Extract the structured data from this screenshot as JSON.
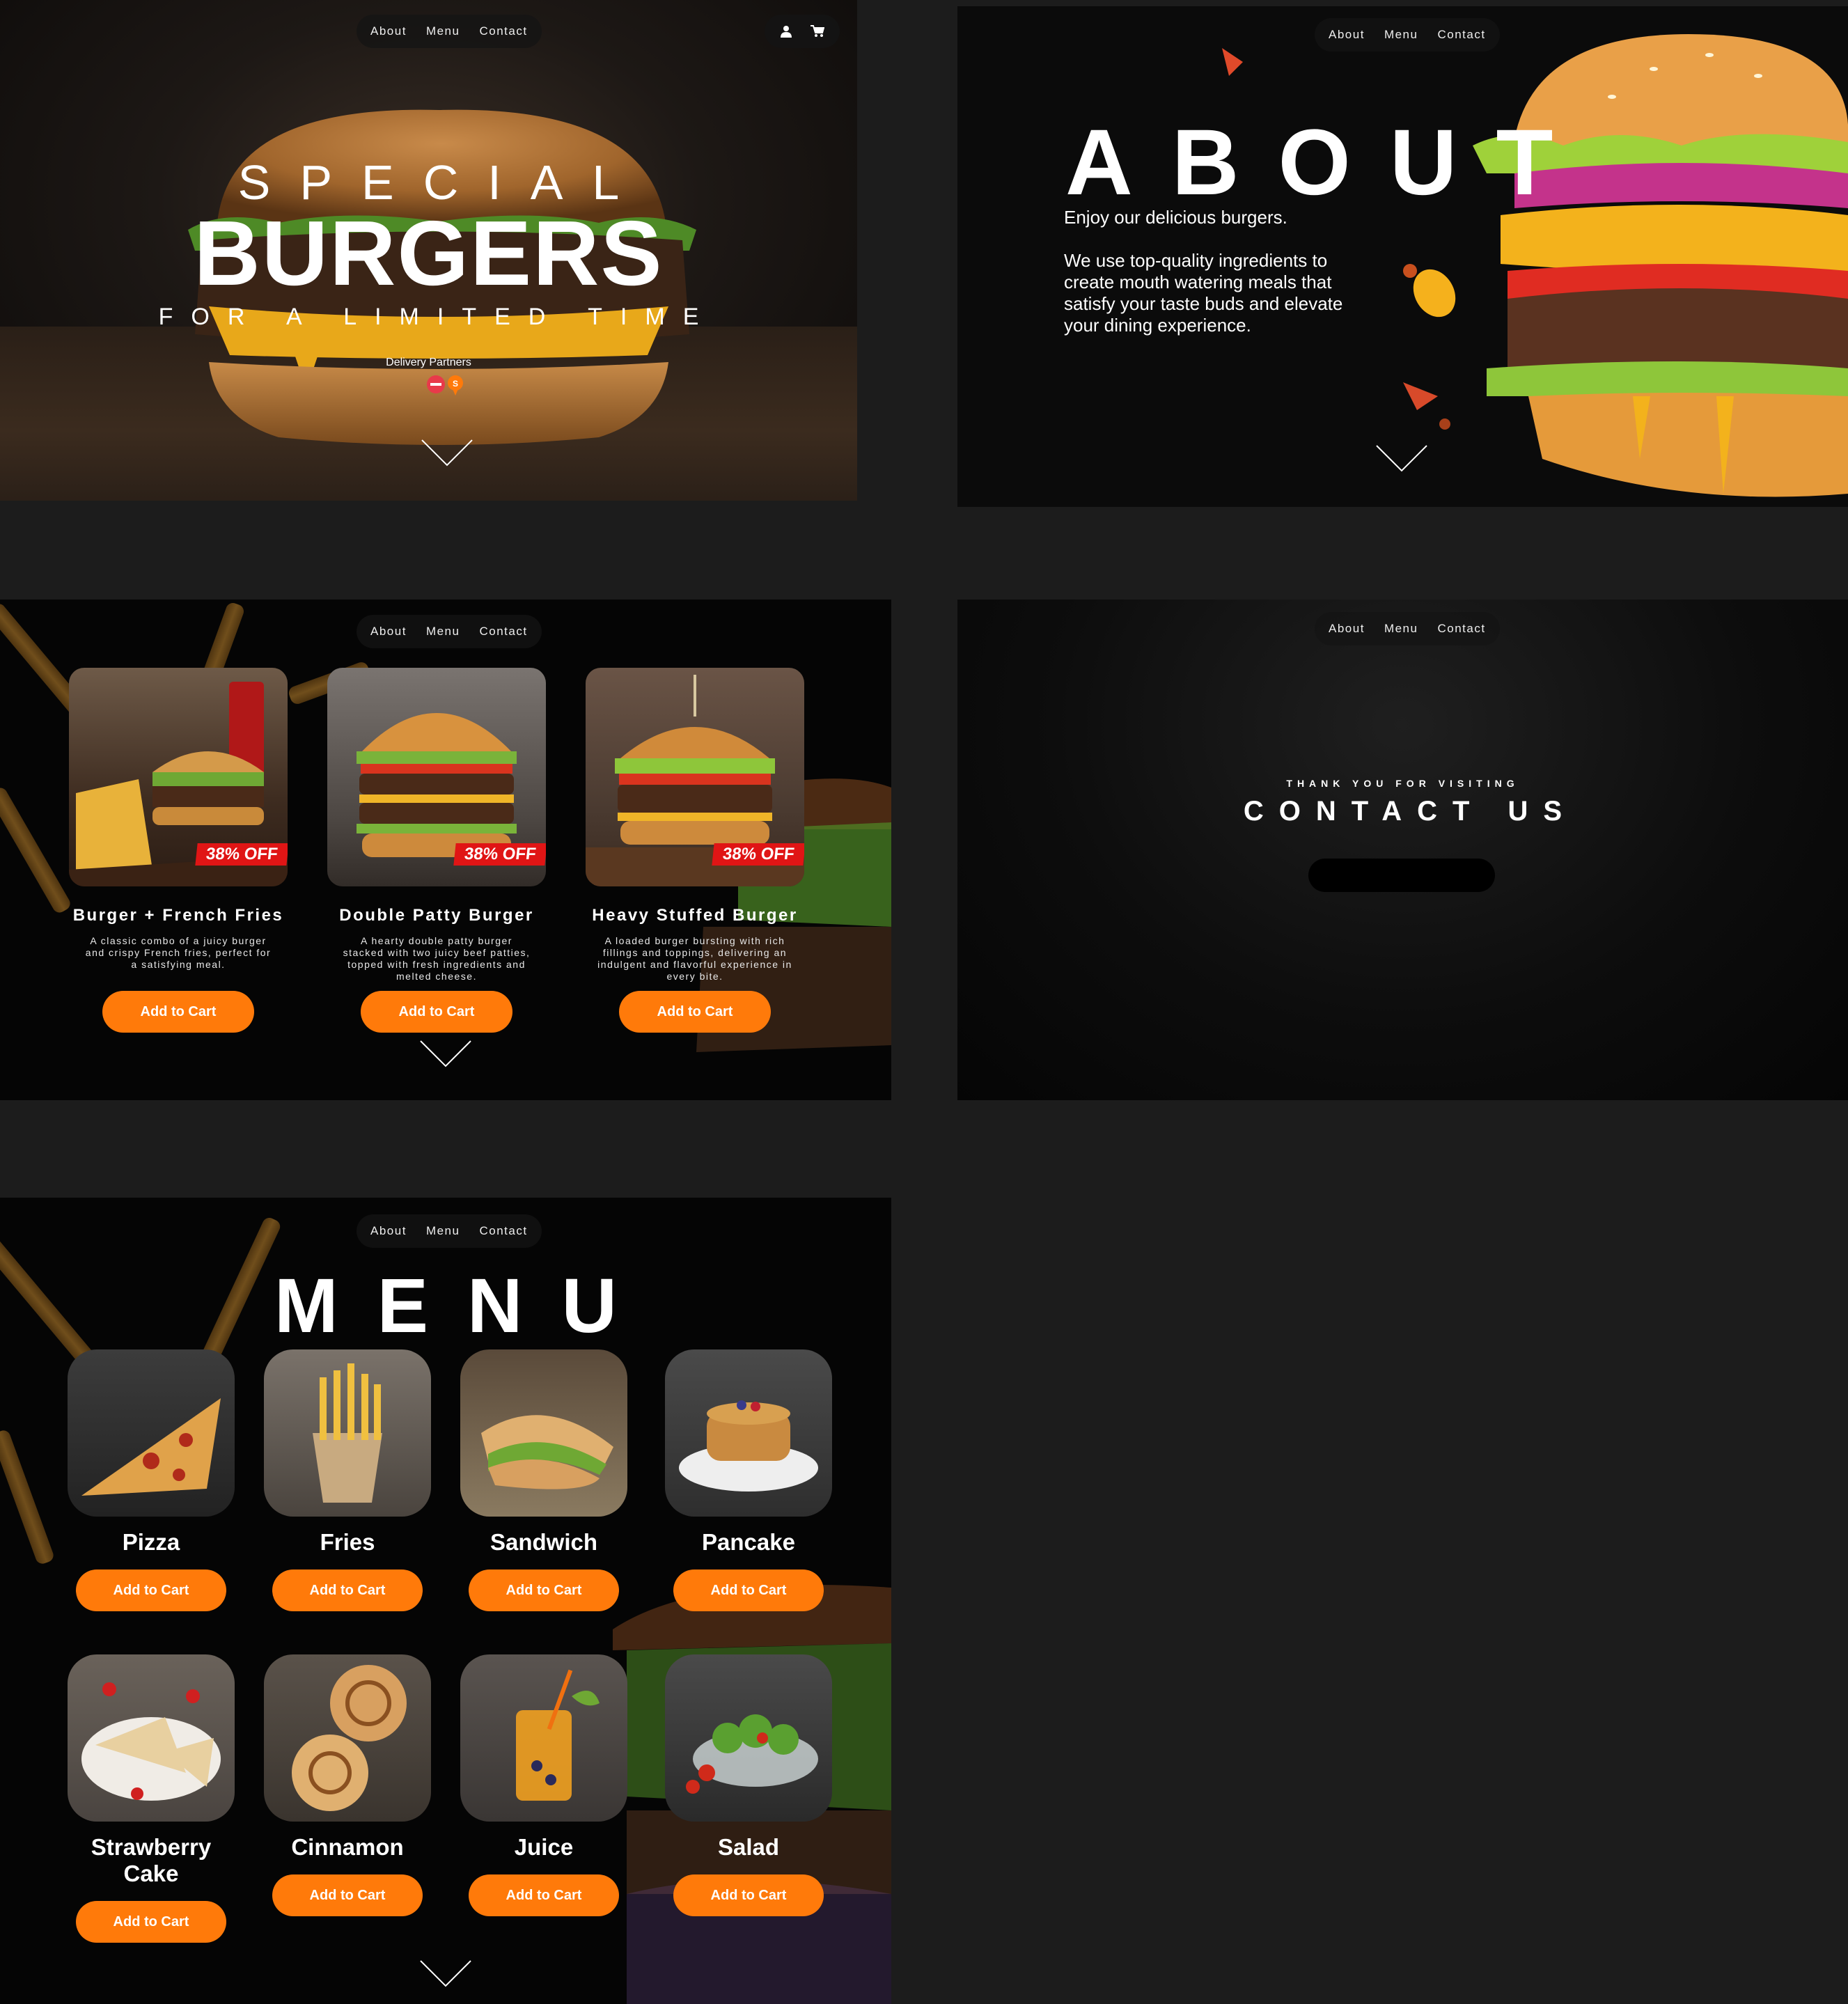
{
  "nav": {
    "about": "About",
    "menu": "Menu",
    "contact": "Contact"
  },
  "hero": {
    "line1": "SPECIAL",
    "line2": "BURGERS",
    "line3": "FOR A LIMITED TIME",
    "delivery_label": "Delivery Partners",
    "icons": [
      "user-icon",
      "cart-icon"
    ]
  },
  "about": {
    "title": "ABOUT",
    "intro": "Enjoy our delicious burgers.",
    "body": "We use top-quality ingredients to create mouth watering meals that satisfy  your taste buds and elevate your dining experience."
  },
  "specials": {
    "cards": [
      {
        "title": "Burger + French Fries",
        "desc": "A classic combo of a juicy burger and crispy French fries, perfect for a satisfying meal.",
        "badge": "38% OFF",
        "button": "Add to Cart"
      },
      {
        "title": "Double Patty Burger",
        "desc": "A hearty double patty burger stacked with two juicy beef patties, topped with fresh ingredients and melted cheese.",
        "badge": "38% OFF",
        "button": "Add to Cart"
      },
      {
        "title": "Heavy Stuffed Burger",
        "desc": "A loaded burger bursting with rich fillings  and toppings, delivering an indulgent and flavorful experience in every bite.",
        "badge": "38% OFF",
        "button": "Add to Cart"
      }
    ]
  },
  "contact": {
    "pretitle": "THANK YOU FOR VISITING",
    "title": "CONTACT US"
  },
  "menu": {
    "title": "MENU",
    "items": [
      {
        "name": "Pizza",
        "button": "Add to Cart"
      },
      {
        "name": "Fries",
        "button": "Add to Cart"
      },
      {
        "name": "Sandwich",
        "button": "Add to Cart"
      },
      {
        "name": "Pancake",
        "button": "Add to Cart"
      },
      {
        "name": "Strawberry Cake",
        "button": "Add to Cart"
      },
      {
        "name": "Cinnamon",
        "button": "Add to Cart"
      },
      {
        "name": "Juice",
        "button": "Add to Cart"
      },
      {
        "name": "Salad",
        "button": "Add to Cart"
      }
    ]
  },
  "colors": {
    "accent": "#ff7a0a",
    "badge": "#e01515",
    "background": "#1c1c1c"
  }
}
